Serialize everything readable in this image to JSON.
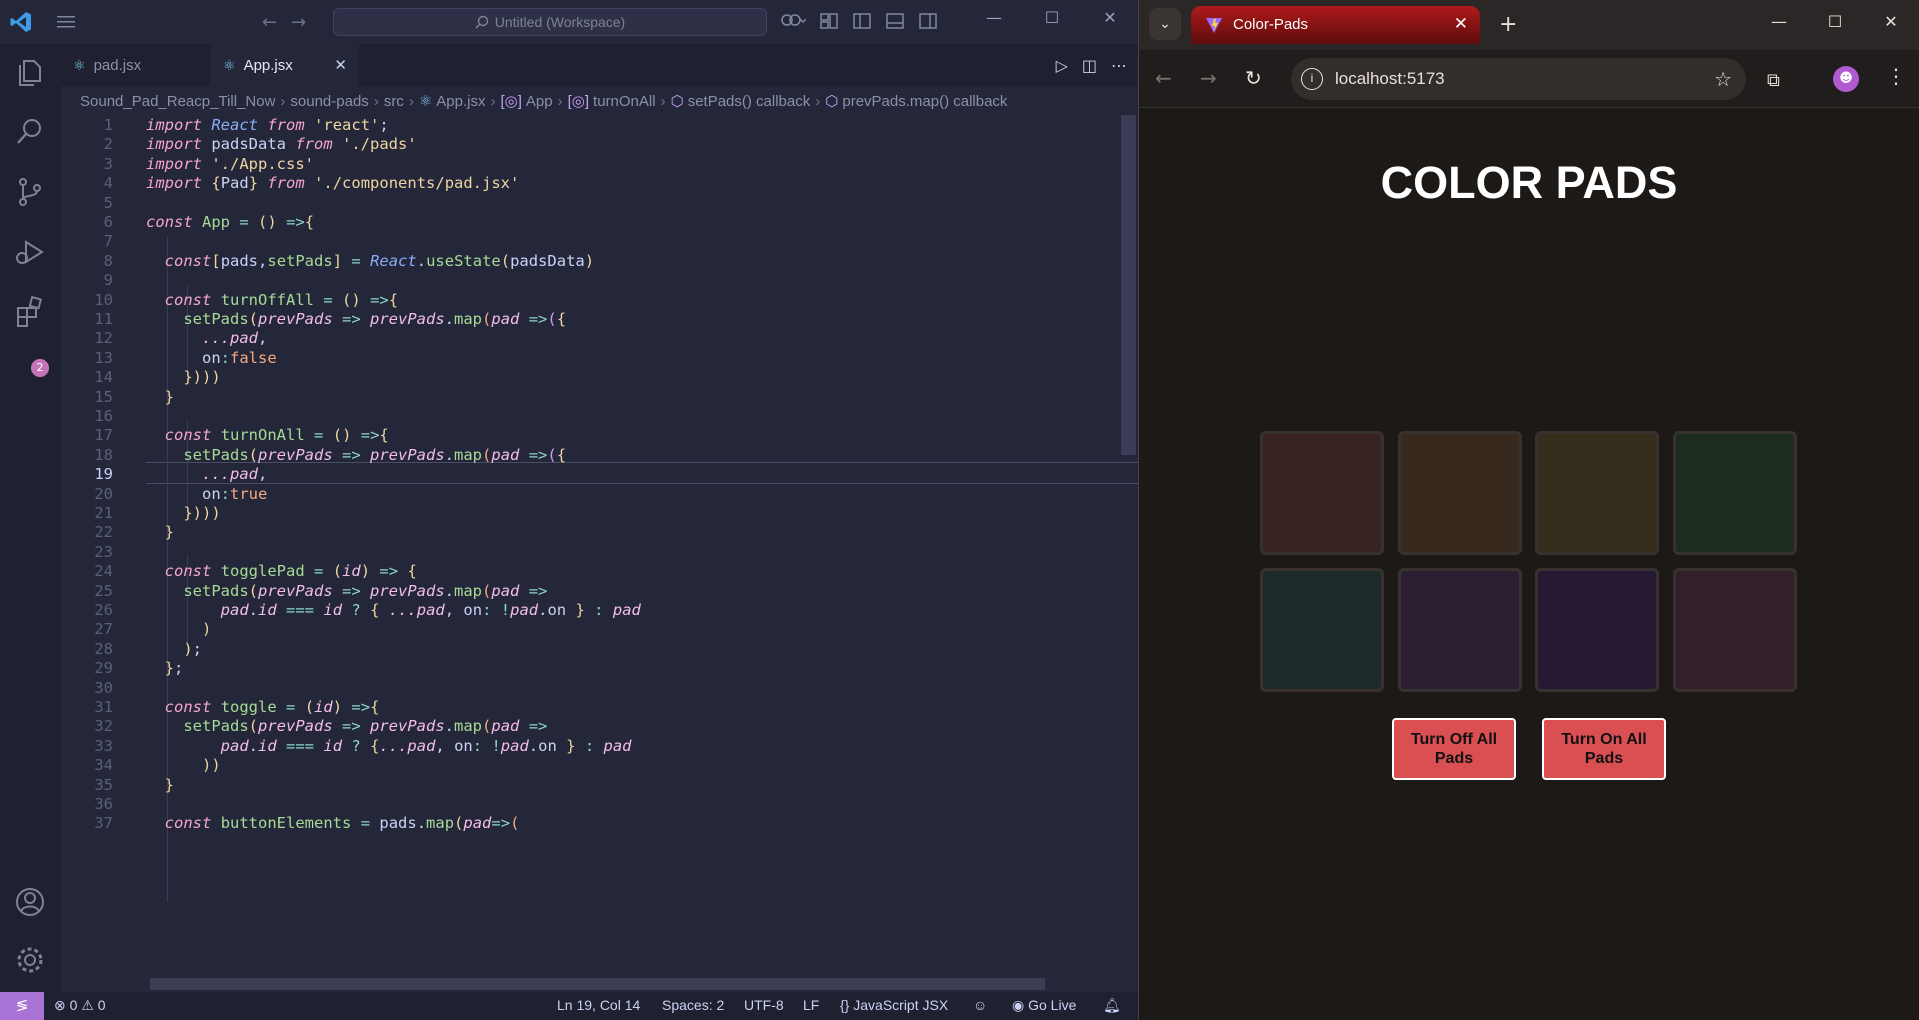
{
  "vscode": {
    "command_center": "Untitled (Workspace)",
    "tabs": [
      {
        "label": "pad.jsx",
        "active": false
      },
      {
        "label": "App.jsx",
        "active": true
      }
    ],
    "breadcrumb": [
      "Sound_Pad_Reacp_Till_Now",
      "sound-pads",
      "src",
      "App.jsx",
      "App",
      "turnOnAll",
      "setPads() callback",
      "prevPads.map() callback"
    ],
    "activity_badge": "2",
    "code_lines": [
      {
        "n": "1",
        "t": "import React from 'react';"
      },
      {
        "n": "2",
        "t": "import padsData from './pads'"
      },
      {
        "n": "3",
        "t": "import './App.css'"
      },
      {
        "n": "4",
        "t": "import {Pad} from './components/pad.jsx'"
      },
      {
        "n": "5",
        "t": ""
      },
      {
        "n": "6",
        "t": "const App = () =>{"
      },
      {
        "n": "7",
        "t": ""
      },
      {
        "n": "8",
        "t": "  const[pads,setPads] = React.useState(padsData)"
      },
      {
        "n": "9",
        "t": ""
      },
      {
        "n": "10",
        "t": "  const turnOffAll = () =>{"
      },
      {
        "n": "11",
        "t": "    setPads(prevPads => prevPads.map(pad =>({"
      },
      {
        "n": "12",
        "t": "      ...pad,"
      },
      {
        "n": "13",
        "t": "      on:false"
      },
      {
        "n": "14",
        "t": "    })))"
      },
      {
        "n": "15",
        "t": "  }"
      },
      {
        "n": "16",
        "t": ""
      },
      {
        "n": "17",
        "t": "  const turnOnAll = () =>{"
      },
      {
        "n": "18",
        "t": "    setPads(prevPads => prevPads.map(pad =>({"
      },
      {
        "n": "19",
        "t": "      ...pad,"
      },
      {
        "n": "20",
        "t": "      on:true"
      },
      {
        "n": "21",
        "t": "    })))"
      },
      {
        "n": "22",
        "t": "  }"
      },
      {
        "n": "23",
        "t": ""
      },
      {
        "n": "24",
        "t": "  const togglePad = (id) => {"
      },
      {
        "n": "25",
        "t": "    setPads(prevPads => prevPads.map(pad =>"
      },
      {
        "n": "26",
        "t": "        pad.id === id ? { ...pad, on: !pad.on } : pad"
      },
      {
        "n": "27",
        "t": "      )"
      },
      {
        "n": "28",
        "t": "    );"
      },
      {
        "n": "29",
        "t": "  };"
      },
      {
        "n": "30",
        "t": ""
      },
      {
        "n": "31",
        "t": "  const toggle = (id) =>{"
      },
      {
        "n": "32",
        "t": "    setPads(prevPads => prevPads.map(pad =>"
      },
      {
        "n": "33",
        "t": "        pad.id === id ? {...pad, on: !pad.on } : pad"
      },
      {
        "n": "34",
        "t": "      ))"
      },
      {
        "n": "35",
        "t": "  }"
      },
      {
        "n": "36",
        "t": ""
      },
      {
        "n": "37",
        "t": "  const buttonElements = pads.map(pad=>("
      }
    ],
    "current_line": "19",
    "status": {
      "errors": "0",
      "warnings": "0",
      "position": "Ln 19, Col 14",
      "spaces": "Spaces: 2",
      "encoding": "UTF-8",
      "eol": "LF",
      "language": "JavaScript JSX",
      "go_live": "Go Live"
    }
  },
  "browser": {
    "tab_title": "Color-Pads",
    "url": "localhost:5173",
    "profile_initial": "",
    "page": {
      "title": "COLOR PADS",
      "pads": [
        {
          "color": "#3a2222",
          "on": false
        },
        {
          "color": "#3a2a20",
          "on": false
        },
        {
          "color": "#38301d",
          "on": false
        },
        {
          "color": "#1f2e20",
          "on": false
        },
        {
          "color": "#1f2a2b",
          "on": false
        },
        {
          "color": "#2c1f33",
          "on": false
        },
        {
          "color": "#261a36",
          "on": false
        },
        {
          "color": "#33212b",
          "on": false
        }
      ],
      "buttons": {
        "off_label": "Turn Off All Pads",
        "on_label": "Turn On All Pads"
      }
    }
  },
  "colors": {
    "accent": "#a873d4",
    "button": "#d94f52",
    "tab_red": "#b01a1a"
  }
}
